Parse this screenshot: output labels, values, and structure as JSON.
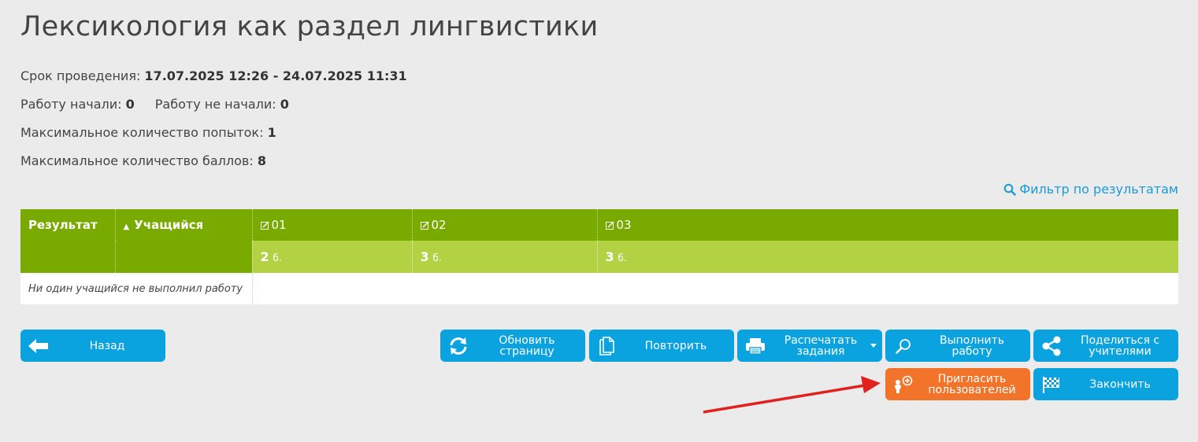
{
  "page": {
    "title": "Лексикология как раздел лингвистики"
  },
  "info": {
    "period_label": "Срок проведения:",
    "period_value": "17.07.2025 12:26 - 24.07.2025 11:31",
    "started_label": "Работу начали:",
    "started_value": "0",
    "not_started_label": "Работу не начали:",
    "not_started_value": "0",
    "max_attempts_label": "Максимальное количество попыток:",
    "max_attempts_value": "1",
    "max_points_label": "Максимальное количество баллов:",
    "max_points_value": "8"
  },
  "filter": {
    "label": "Фильтр по результатам",
    "icon": "search-icon"
  },
  "table": {
    "col_result": "Результат",
    "col_student": "Учащийся",
    "tasks": [
      {
        "label": "01",
        "points": "2",
        "unit": "б."
      },
      {
        "label": "02",
        "points": "3",
        "unit": "б."
      },
      {
        "label": "03",
        "points": "3",
        "unit": "б."
      }
    ],
    "empty_message": "Ни один учащийся не выполнил работу"
  },
  "buttons": {
    "back": "Назад",
    "refresh": "Обновить страницу",
    "repeat": "Повторить",
    "print": "Распечатать задания",
    "do_work": "Выполнить работу",
    "share": "Поделиться с учителями",
    "invite": "Пригласить пользователей",
    "finish": "Закончить"
  },
  "colors": {
    "button_blue": "#0aa3e0",
    "button_orange": "#f2732a",
    "header_dark_green": "#78aa00",
    "header_light_green": "#b2d243",
    "link_blue": "#1a9ad9",
    "annotation_arrow": "#e0221f"
  }
}
